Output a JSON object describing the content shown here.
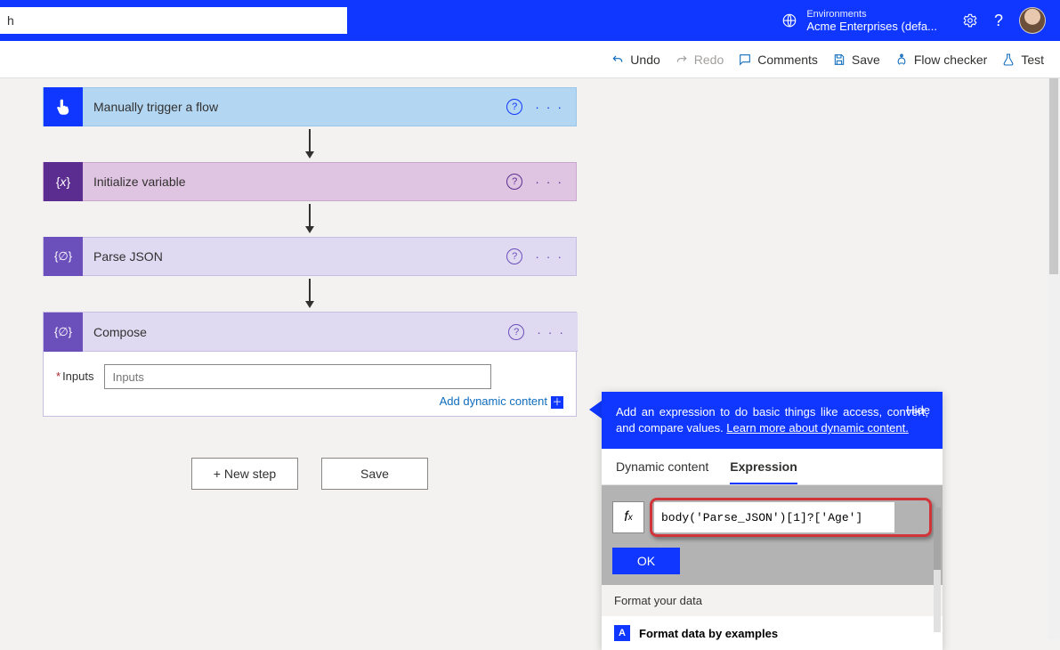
{
  "topbar": {
    "search_value": "h",
    "env_label": "Environments",
    "env_name": "Acme Enterprises (defa..."
  },
  "toolbar": {
    "undo": "Undo",
    "redo": "Redo",
    "comments": "Comments",
    "save": "Save",
    "flow_checker": "Flow checker",
    "test": "Test"
  },
  "steps": {
    "trigger": "Manually trigger a flow",
    "init_var": "Initialize variable",
    "parse_json": "Parse JSON",
    "compose": "Compose",
    "inputs_label": "Inputs",
    "inputs_placeholder": "Inputs",
    "add_dynamic": "Add dynamic content"
  },
  "buttons": {
    "new_step": "+ New step",
    "save": "Save"
  },
  "dyn": {
    "header_text_1": "Add an expression to do basic things like access, convert, and compare values. ",
    "header_link": "Learn more about dynamic content.",
    "hide": "Hide",
    "tab_dynamic": "Dynamic content",
    "tab_expression": "Expression",
    "fx": "f",
    "fx_sub": "x",
    "expression_value": "body('Parse_JSON')[1]?['Age']",
    "ok": "OK",
    "format_header": "Format your data",
    "format_item": "Format data by examples"
  }
}
